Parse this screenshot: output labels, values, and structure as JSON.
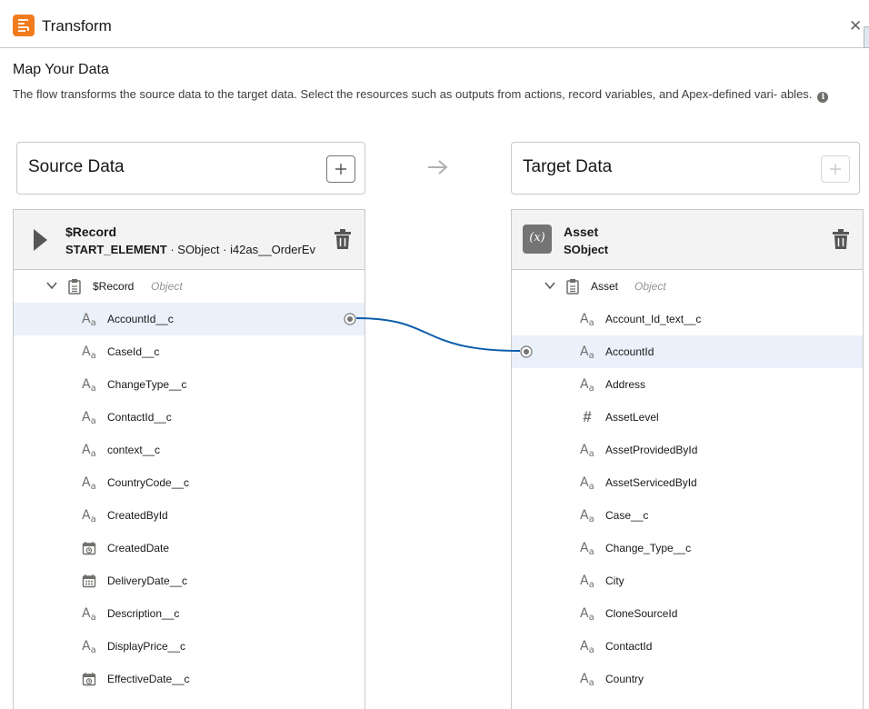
{
  "header": {
    "title": "Transform",
    "icon": "transform-icon",
    "close_icon": "close-icon"
  },
  "main": {
    "title": "Map Your Data",
    "description": "The flow transforms the source data to the target data. Select the resources such as outputs from actions, record variables, and Apex-defined vari- ables."
  },
  "source_card": {
    "title": "Source Data",
    "add_icon": "plus-icon"
  },
  "target_card": {
    "title": "Target Data",
    "add_icon": "plus-icon"
  },
  "source": {
    "name": "$Record",
    "type_label": "START_ELEMENT",
    "sub_rest": " · SObject · i42as__OrderEv",
    "root": {
      "name": "$Record",
      "type": "Object"
    },
    "fields": [
      {
        "label": "AccountId__c",
        "icon": "text-icon",
        "selected": true,
        "connected": true
      },
      {
        "label": "CaseId__c",
        "icon": "text-icon"
      },
      {
        "label": "ChangeType__c",
        "icon": "text-icon"
      },
      {
        "label": "ContactId__c",
        "icon": "text-icon"
      },
      {
        "label": "context__c",
        "icon": "text-icon"
      },
      {
        "label": "CountryCode__c",
        "icon": "text-icon"
      },
      {
        "label": "CreatedById",
        "icon": "text-icon"
      },
      {
        "label": "CreatedDate",
        "icon": "datetime-icon"
      },
      {
        "label": "DeliveryDate__c",
        "icon": "date-icon"
      },
      {
        "label": "Description__c",
        "icon": "text-icon"
      },
      {
        "label": "DisplayPrice__c",
        "icon": "text-icon"
      },
      {
        "label": "EffectiveDate__c",
        "icon": "datetime-icon"
      }
    ]
  },
  "target": {
    "name": "Asset",
    "type_label": "SObject",
    "root": {
      "name": "Asset",
      "type": "Object"
    },
    "fields": [
      {
        "label": "Account_Id_text__c",
        "icon": "text-icon"
      },
      {
        "label": "AccountId",
        "icon": "text-icon",
        "selected": true,
        "connected": true
      },
      {
        "label": "Address",
        "icon": "text-icon"
      },
      {
        "label": "AssetLevel",
        "icon": "number-icon"
      },
      {
        "label": "AssetProvidedById",
        "icon": "text-icon"
      },
      {
        "label": "AssetServicedById",
        "icon": "text-icon"
      },
      {
        "label": "Case__c",
        "icon": "text-icon"
      },
      {
        "label": "Change_Type__c",
        "icon": "text-icon"
      },
      {
        "label": "City",
        "icon": "text-icon"
      },
      {
        "label": "CloneSourceId",
        "icon": "text-icon"
      },
      {
        "label": "ContactId",
        "icon": "text-icon"
      },
      {
        "label": "Country",
        "icon": "text-icon"
      }
    ]
  },
  "colors": {
    "accent": "#f17c1d",
    "connector": "#0b5cab",
    "selected_row": "#eaf1fb"
  }
}
